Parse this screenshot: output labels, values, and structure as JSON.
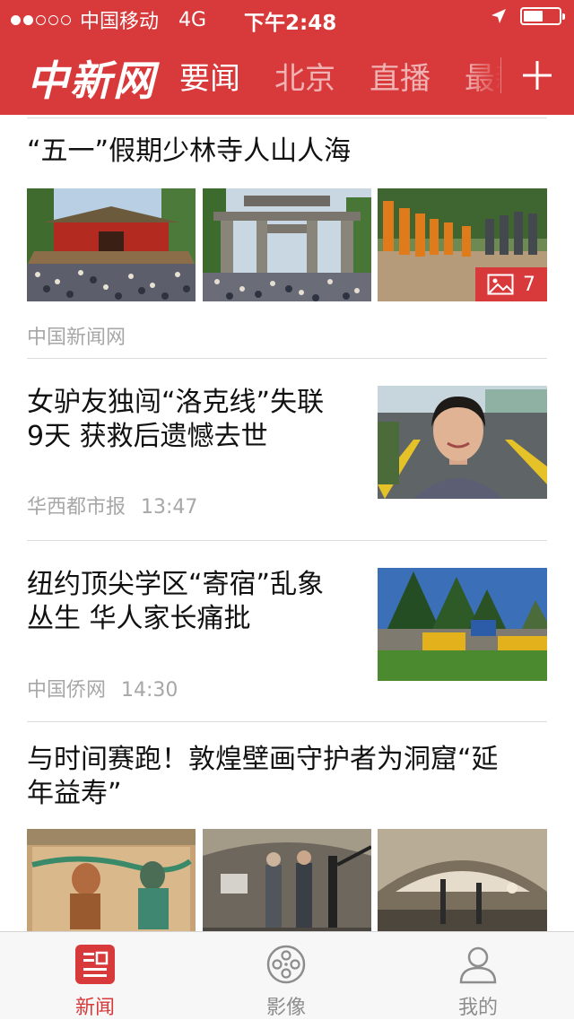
{
  "status_bar": {
    "carrier": "中国移动",
    "network": "4G",
    "time": "下午2:48",
    "signal_dots_filled": 2,
    "signal_dots_total": 5,
    "battery_level": 0.55
  },
  "header": {
    "logo": "中新网",
    "tabs": [
      {
        "label": "要闻",
        "active": true
      },
      {
        "label": "北京",
        "active": false
      },
      {
        "label": "直播",
        "active": false
      },
      {
        "label": "最新",
        "active": false
      }
    ],
    "add_icon": "plus-icon"
  },
  "articles": [
    {
      "title": "“五一”假期少林寺人山人海",
      "source": "中国新闻网",
      "time": "",
      "images": [
        "shaolin-temple-crowd",
        "temple-gate-crowd",
        "monks-procession"
      ],
      "photo_count": "7"
    },
    {
      "title": "女驴友独闯“洛克线”失联9天 获救后遗憾去世",
      "title_lines": [
        "女驴友独闯“洛克线”失联",
        "9天 获救后遗憾去世"
      ],
      "source": "华西都市报",
      "time": "13:47"
    },
    {
      "title": "纽约顶尖学区“寄宿”乱象丛生 华人家长痛批",
      "title_lines": [
        "纽约顶尖学区“寄宿”乱象",
        "丛生 华人家长痛批"
      ],
      "source": "中国侨网",
      "time": "14:30"
    },
    {
      "title": "与时间赛跑！敦煌壁画守护者为洞窟“延年益寿”",
      "title_lines": [
        "与时间赛跑！敦煌壁画守护者为洞窟“延",
        "年益寿”"
      ],
      "images": [
        "mural-painting",
        "restorers-at-work",
        "cave-interior"
      ]
    }
  ],
  "tab_bar": {
    "items": [
      {
        "label": "新闻",
        "icon": "news-icon",
        "active": true
      },
      {
        "label": "影像",
        "icon": "film-reel-icon",
        "active": false
      },
      {
        "label": "我的",
        "icon": "person-icon",
        "active": false
      }
    ]
  },
  "colors": {
    "brand_red": "#d8393a",
    "source_gray": "#a7a7a7",
    "tabbar_bg": "#f7f7f7"
  }
}
